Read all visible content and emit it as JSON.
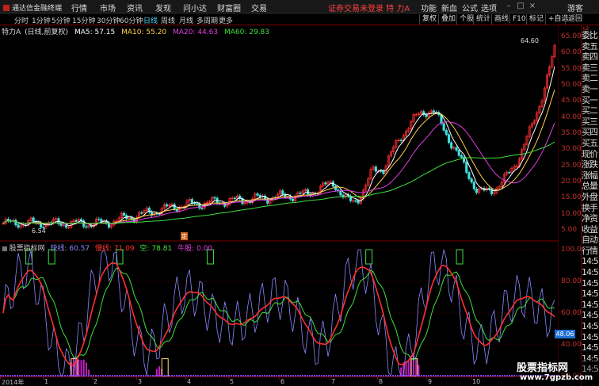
{
  "app": {
    "title": "通达信金融终端",
    "menus": [
      "行情",
      "市场",
      "资讯",
      "发现",
      "问小达",
      "财富圈",
      "交易"
    ],
    "status": "证券交易未登录  特 力A",
    "right_menus": [
      "功能",
      "新血",
      "公式",
      "选项"
    ],
    "user": "游客"
  },
  "periods": {
    "items": [
      "分时",
      "1分钟",
      "5分钟",
      "15分钟",
      "30分钟",
      "60分钟",
      "日线",
      "周线",
      "月线",
      "多周期",
      "更多"
    ],
    "active": "日线"
  },
  "toolbar": {
    "items": [
      "复权",
      "叠加",
      "个股",
      "统计",
      "画线",
      "F10",
      "标记",
      "+自选",
      "返回"
    ]
  },
  "main_chart": {
    "title": "特力A",
    "subtitle": "(日线,前复权)",
    "ma": [
      {
        "label": "MA5: 57.15",
        "color": "#ffffff"
      },
      {
        "label": "MA10: 55.20",
        "color": "#ffd24a"
      },
      {
        "label": "MA20: 44.63",
        "color": "#e040e0"
      },
      {
        "label": "MA60: 29.83",
        "color": "#40e040"
      }
    ],
    "high_label": "64.60",
    "low_label": "6.54",
    "ding_label": "定",
    "price_ticks": [
      "65.00",
      "60.00",
      "55.00",
      "50.00",
      "45.00",
      "40.00",
      "35.00",
      "30.00",
      "25.00",
      "20.00",
      "15.00",
      "10.00",
      "5.00"
    ]
  },
  "indicator": {
    "name": "股票指标网",
    "fast": {
      "label": "快线: 60.57",
      "color": "#8888ff"
    },
    "slow": {
      "label": "慢线: 71.09",
      "color": "#ff3030"
    },
    "empty": {
      "label": "空: 78.81",
      "color": "#40e040"
    },
    "bull": {
      "label": "牛股: 0.00",
      "color": "#e040e0"
    },
    "ticks": [
      "100.0",
      "80.00",
      "60.00",
      "40.00",
      "20.00"
    ],
    "current_value": "48.06"
  },
  "sidebar": {
    "tag": "L2",
    "items": [
      "委比",
      "卖五",
      "卖四",
      "卖三",
      "卖二",
      "卖一",
      "买一",
      "买二",
      "买三",
      "买四",
      "买五",
      "现价",
      "涨跌",
      "涨幅",
      "总量",
      "外盘",
      "换手",
      "净资",
      "收益",
      "自动",
      "行情",
      "14:5",
      "14:5",
      "14:5",
      "14:5",
      "14:5",
      "14:5",
      "14:5",
      "14:5",
      "14:5",
      "14:5",
      "14:5"
    ]
  },
  "date_axis": [
    "2014年",
    "1",
    "2",
    "3",
    "4",
    "5",
    "6",
    "7",
    "8",
    "9",
    "10"
  ],
  "watermark": {
    "line1": "股票指标网",
    "line2": "www.7gpzb.com"
  },
  "colors": {
    "up": "#ff3030",
    "down": "#40e0e0",
    "axis": "#7a0000",
    "active": "#4ad8ff"
  }
}
